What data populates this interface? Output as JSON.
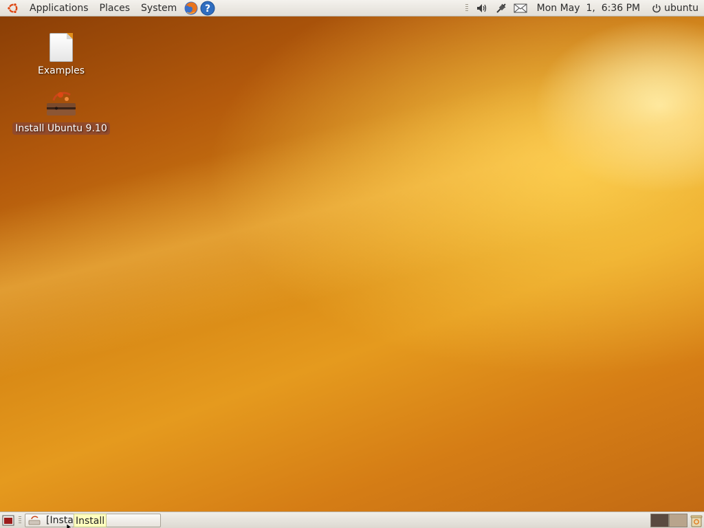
{
  "top_panel": {
    "menus": [
      "Applications",
      "Places",
      "System"
    ],
    "launchers": [
      "firefox-icon",
      "help-icon"
    ],
    "tray_icons": [
      "volume-icon",
      "network-icon",
      "mail-icon"
    ],
    "clock": "Mon May  1,  6:36 PM",
    "user": "ubuntu"
  },
  "desktop": {
    "icons": [
      {
        "label": "Examples",
        "icon": "document-icon"
      },
      {
        "label": "Install Ubuntu 9.10",
        "icon": "installer-icon",
        "selected": true
      }
    ]
  },
  "bottom_panel": {
    "task": {
      "label": "[Instal",
      "icon": "installer-icon"
    },
    "tooltip": "Install",
    "workspaces": 2,
    "active_workspace": 1
  },
  "colors": {
    "panel": "#ebe8e2",
    "desktop_accent": "#e59a1e",
    "selection": "#8a4834",
    "tooltip": "#ffffbf"
  }
}
